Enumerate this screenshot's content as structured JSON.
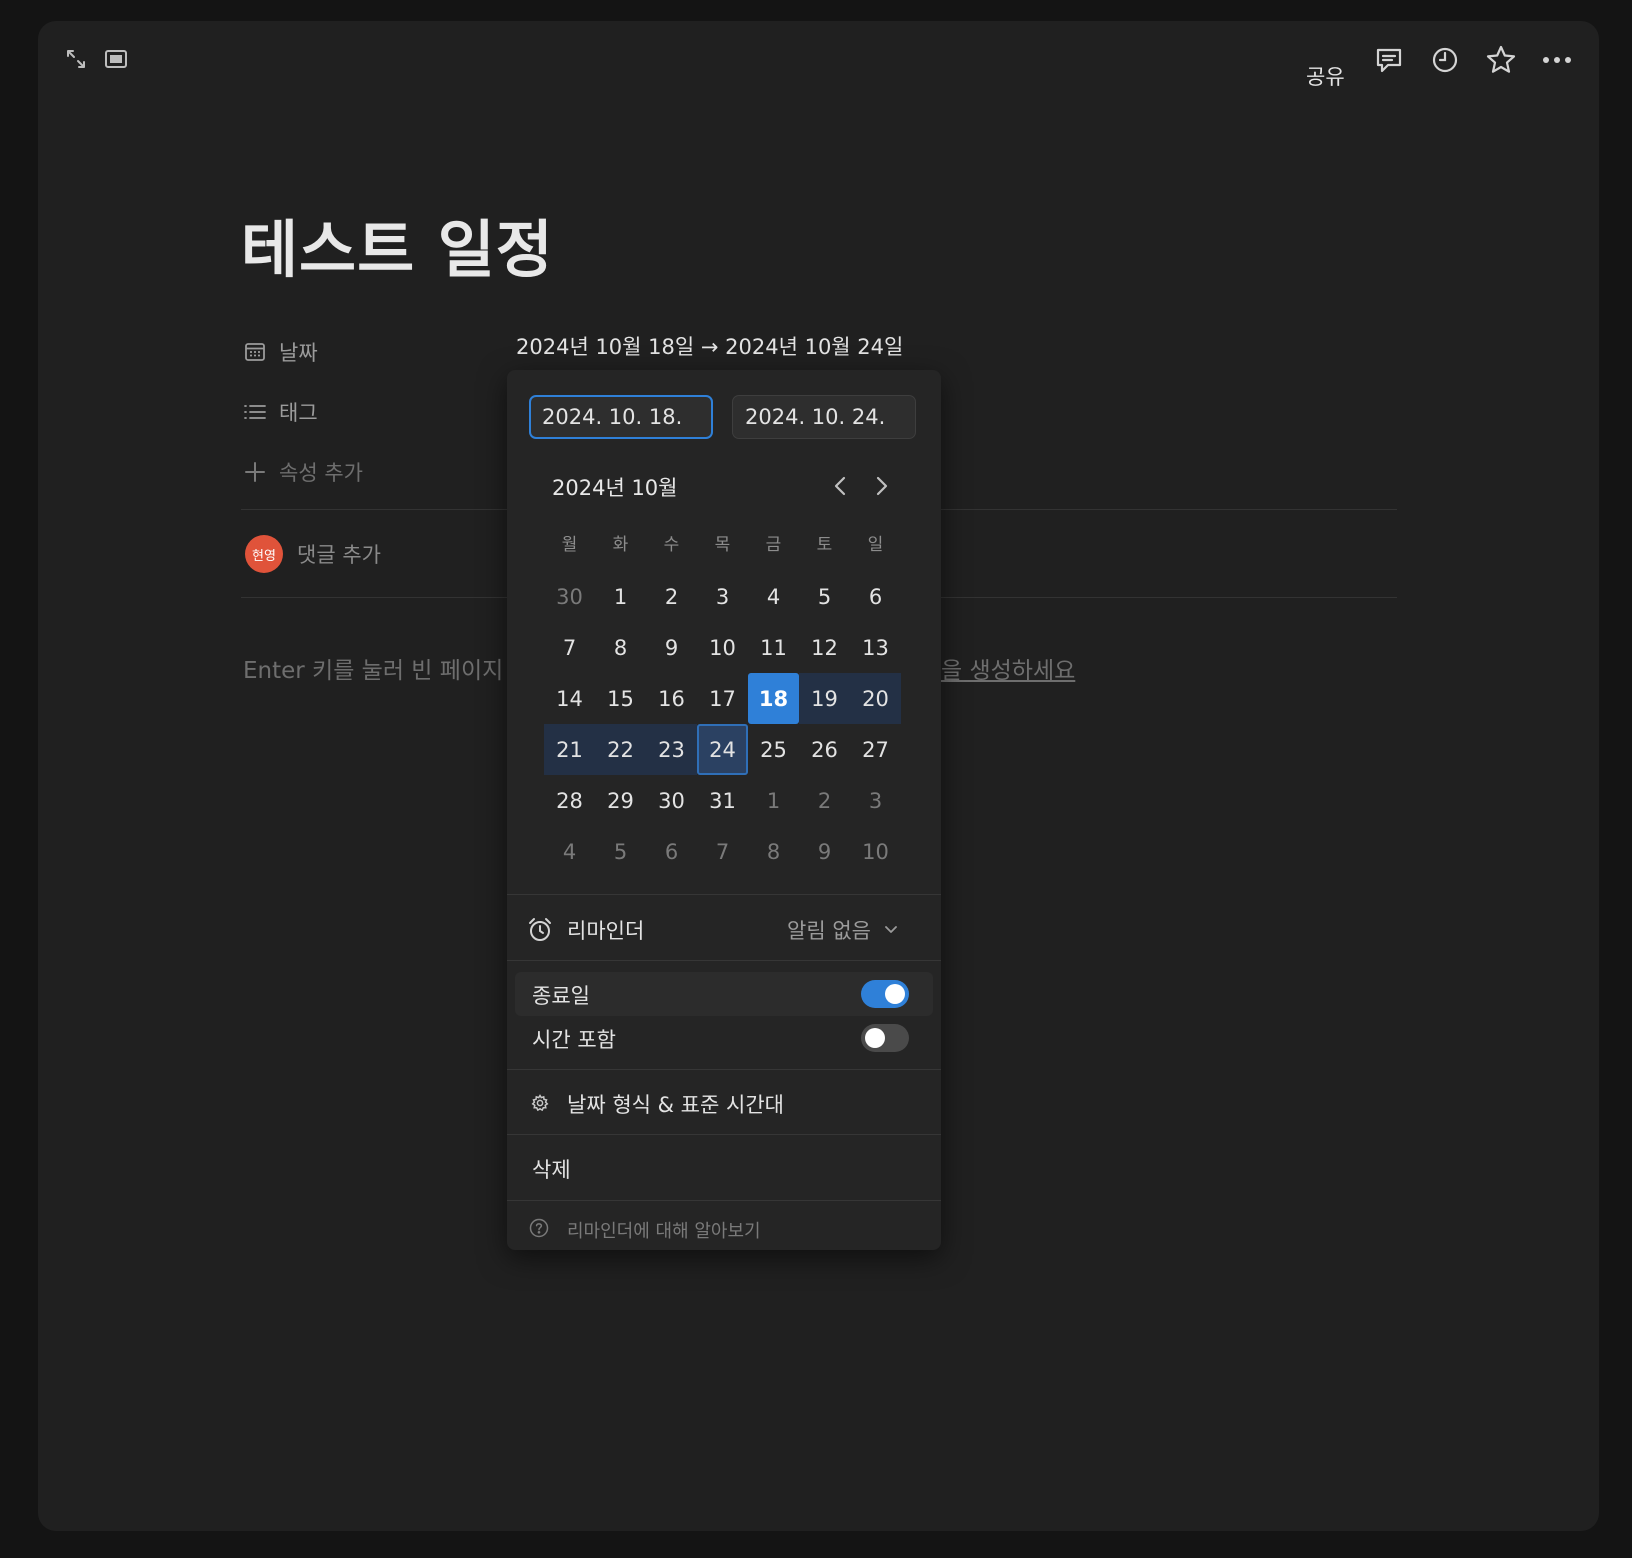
{
  "topbar": {
    "share_label": "공유",
    "icons": [
      "expand-icon",
      "sidepeek-icon",
      "comment-icon",
      "history-icon",
      "star-icon",
      "more-icon"
    ]
  },
  "page": {
    "title": "테스트 일정",
    "properties": [
      {
        "icon": "calendar-icon",
        "label": "날짜",
        "value": "2024년 10월 18일 → 2024년 10월 24일"
      },
      {
        "icon": "list-icon",
        "label": "태그"
      }
    ],
    "add_property_label": "속성 추가",
    "comment": {
      "avatar_text": "현영",
      "placeholder": "댓글 추가"
    },
    "hint_left": "Enter 키를 눌러 빈 페이지",
    "hint_right": "을 생성하세요"
  },
  "date_picker": {
    "start_input": "2024. 10. 18.",
    "end_input": "2024. 10. 24.",
    "month_label": "2024년 10월",
    "weekdays": [
      "월",
      "화",
      "수",
      "목",
      "금",
      "토",
      "일"
    ],
    "days": [
      [
        "30",
        "1",
        "2",
        "3",
        "4",
        "5",
        "6"
      ],
      [
        "7",
        "8",
        "9",
        "10",
        "11",
        "12",
        "13"
      ],
      [
        "14",
        "15",
        "16",
        "17",
        "18",
        "19",
        "20"
      ],
      [
        "21",
        "22",
        "23",
        "24",
        "25",
        "26",
        "27"
      ],
      [
        "28",
        "29",
        "30",
        "31",
        "1",
        "2",
        "3"
      ],
      [
        "4",
        "5",
        "6",
        "7",
        "8",
        "9",
        "10"
      ]
    ],
    "reminder_label": "리마인더",
    "reminder_value": "알림 없음",
    "end_date_label": "종료일",
    "end_date_on": true,
    "include_time_label": "시간 포함",
    "include_time_on": false,
    "format_label": "날짜 형식 & 표준 시간대",
    "delete_label": "삭제",
    "learn_label": "리마인더에 대해 알아보기"
  },
  "colors": {
    "accent": "#2f80d8",
    "range": "#233045",
    "avatar": "#e0533a"
  }
}
